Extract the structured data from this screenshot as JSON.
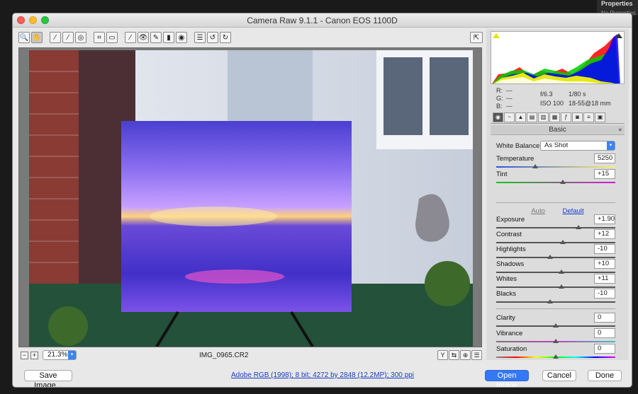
{
  "background": {
    "panel_label": "Properties",
    "panel_sublabel": "No Properties"
  },
  "window": {
    "title": "Camera Raw 9.1.1  -  Canon EOS 1100D"
  },
  "toolbar": {
    "tools": [
      {
        "name": "zoom-tool-icon",
        "glyph": "🔍"
      },
      {
        "name": "hand-tool-icon",
        "glyph": "✋"
      },
      {
        "name": "white-balance-tool-icon",
        "glyph": "⁄"
      },
      {
        "name": "color-sampler-tool-icon",
        "glyph": "⁄"
      },
      {
        "name": "targeted-adjustment-tool-icon",
        "glyph": "◎"
      },
      {
        "name": "crop-tool-icon",
        "glyph": "⌗"
      },
      {
        "name": "straighten-tool-icon",
        "glyph": "▭"
      },
      {
        "name": "spot-removal-tool-icon",
        "glyph": "⁄"
      },
      {
        "name": "red-eye-tool-icon",
        "glyph": "👁"
      },
      {
        "name": "adjustment-brush-icon",
        "glyph": "✎"
      },
      {
        "name": "graduated-filter-icon",
        "glyph": "▮"
      },
      {
        "name": "radial-filter-icon",
        "glyph": "◉"
      },
      {
        "name": "preferences-icon",
        "glyph": "☰"
      },
      {
        "name": "rotate-left-icon",
        "glyph": "↺"
      },
      {
        "name": "rotate-right-icon",
        "glyph": "↻"
      }
    ]
  },
  "preview": {
    "zoom_value": "21.3%",
    "filename": "IMG_0965.CR2"
  },
  "histogram_info": {
    "r_label": "R:",
    "r_value": "---",
    "g_label": "G:",
    "g_value": "---",
    "b_label": "B:",
    "b_value": "---",
    "aperture": "f/6.3",
    "shutter": "1/80 s",
    "iso": "ISO 100",
    "lens": "18-55@18 mm"
  },
  "panel": {
    "section_title": "Basic",
    "white_balance_label": "White Balance:",
    "white_balance_value": "As Shot",
    "auto_label": "Auto",
    "default_label": "Default",
    "sliders": [
      {
        "label": "Temperature",
        "value": "5250",
        "pos": 0.33
      },
      {
        "label": "Tint",
        "value": "+15",
        "pos": 0.56
      },
      {
        "label": "Exposure",
        "value": "+1.90",
        "pos": 0.69
      },
      {
        "label": "Contrast",
        "value": "+12",
        "pos": 0.56
      },
      {
        "label": "Highlights",
        "value": "-10",
        "pos": 0.45
      },
      {
        "label": "Shadows",
        "value": "+10",
        "pos": 0.55
      },
      {
        "label": "Whites",
        "value": "+11",
        "pos": 0.55
      },
      {
        "label": "Blacks",
        "value": "-10",
        "pos": 0.45
      },
      {
        "label": "Clarity",
        "value": "0",
        "pos": 0.5
      },
      {
        "label": "Vibrance",
        "value": "0",
        "pos": 0.5
      },
      {
        "label": "Saturation",
        "value": "0",
        "pos": 0.5
      }
    ]
  },
  "footer": {
    "save_label": "Save Image...",
    "workflow_link": "Adobe RGB (1998); 8 bit; 4272 by 2848 (12.2MP); 300 ppi",
    "open_label": "Open Image",
    "cancel_label": "Cancel",
    "done_label": "Done"
  },
  "colors": {
    "accent": "#3478f6",
    "link": "#1a3dc4"
  }
}
